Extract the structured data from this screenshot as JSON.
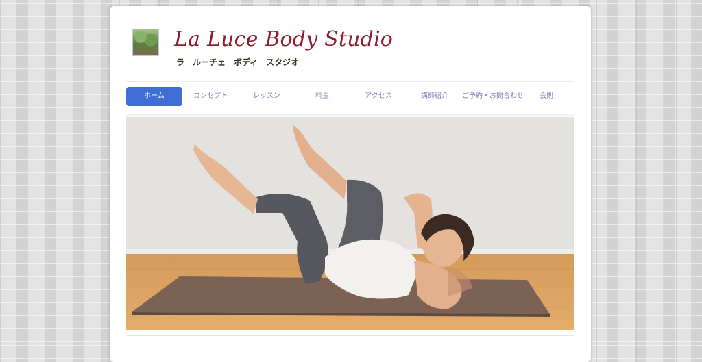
{
  "site": {
    "title": "La Luce Body Studio",
    "subtitle": "ラ　ルーチェ　ボディ　スタジオ"
  },
  "nav": {
    "items": [
      {
        "label": "ホーム",
        "active": true
      },
      {
        "label": "コンセプト",
        "active": false
      },
      {
        "label": "レッスン",
        "active": false
      },
      {
        "label": "料金",
        "active": false
      },
      {
        "label": "アクセス",
        "active": false
      },
      {
        "label": "講師紹介",
        "active": false
      },
      {
        "label": "ご予約・お問合わせ",
        "active": false
      },
      {
        "label": "会則",
        "active": false
      }
    ]
  },
  "colors": {
    "title": "#8c1d2e",
    "nav_active_bg": "#3f6fd6",
    "nav_text": "#8a78b8"
  },
  "hero": {
    "icon": "pilates-exercise-photo"
  }
}
